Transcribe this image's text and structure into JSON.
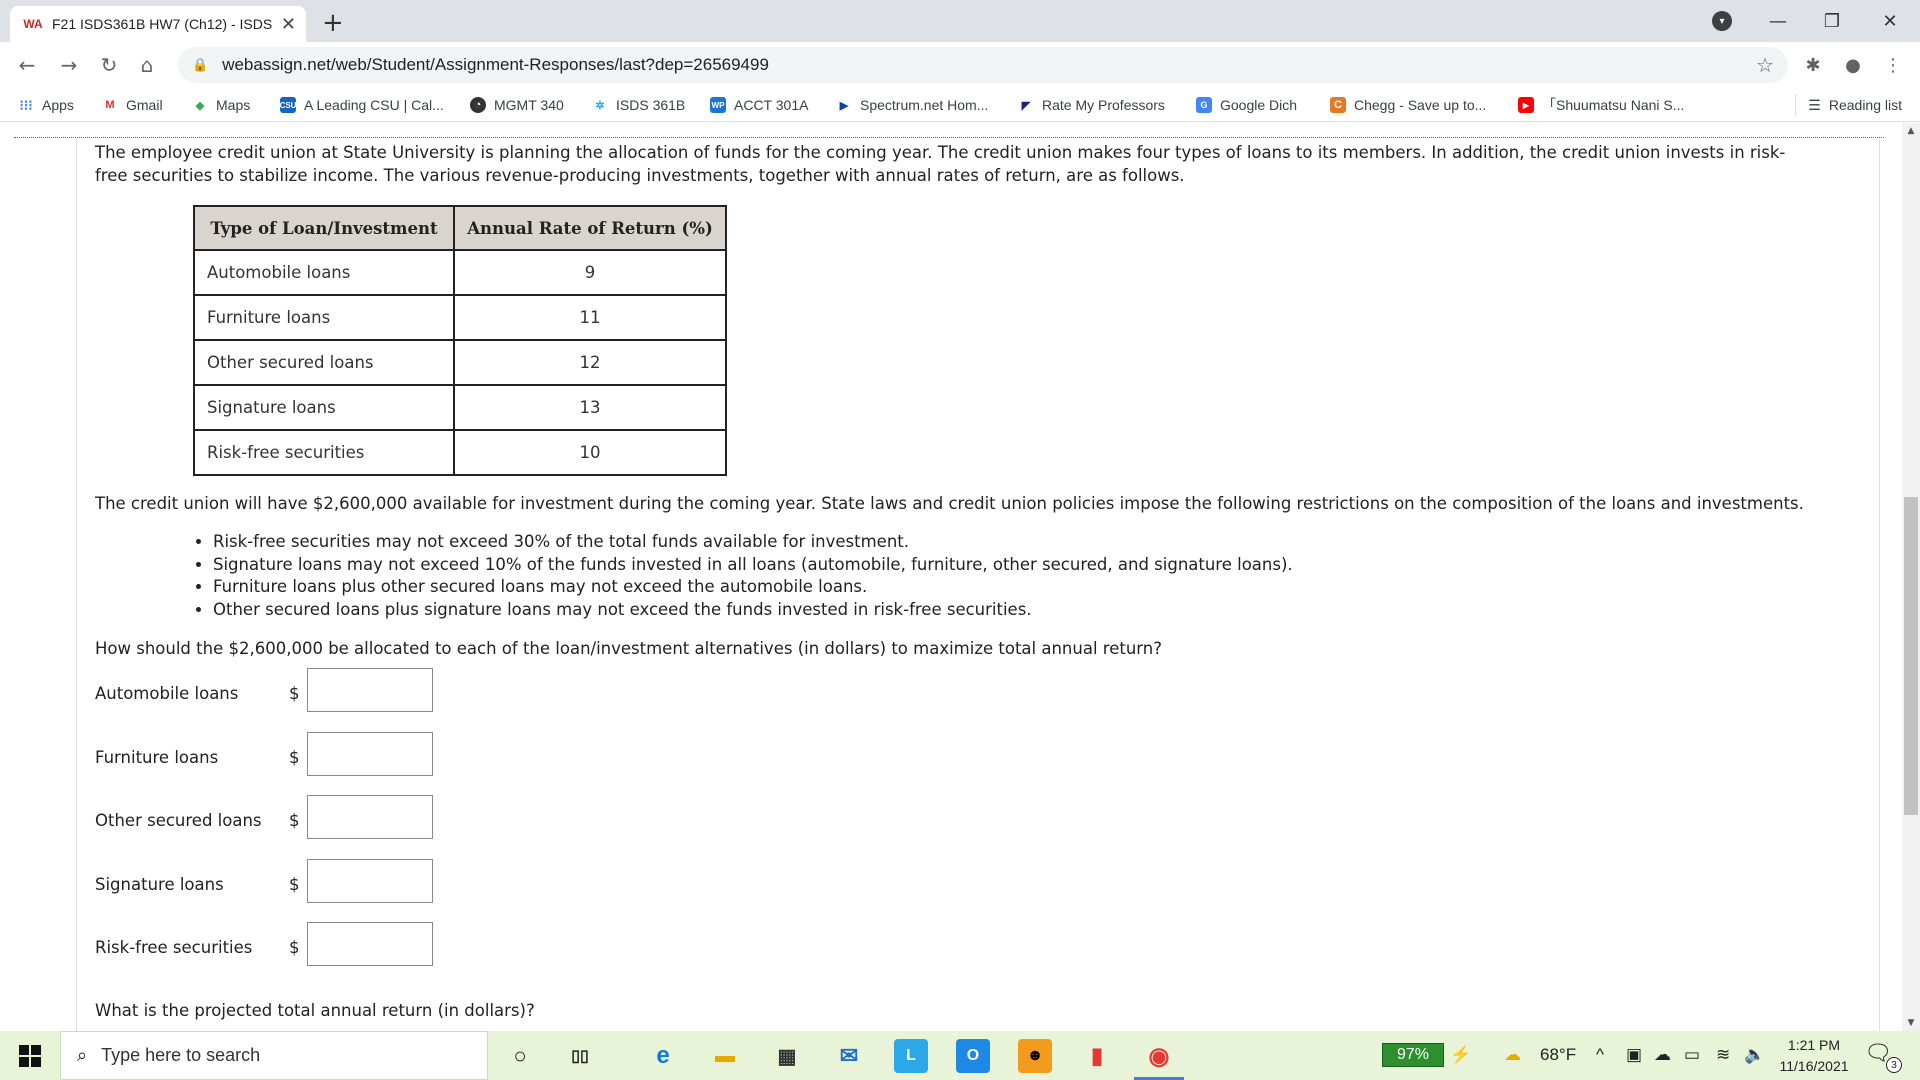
{
  "browser": {
    "tab_title": "F21 ISDS361B HW7 (Ch12) - ISDS",
    "tab_favicon": "WA",
    "new_tab": "+",
    "url": "webassign.net/web/Student/Assignment-Responses/last?dep=26569499",
    "bookmarks": [
      {
        "label": "Apps",
        "icon": "apps-grid-icon"
      },
      {
        "label": "Gmail",
        "icon": "gmail-icon"
      },
      {
        "label": "Maps",
        "icon": "maps-icon"
      },
      {
        "label": "A Leading CSU | Cal...",
        "icon": "csu-icon"
      },
      {
        "label": "MGMT 340",
        "icon": "mgmt-icon"
      },
      {
        "label": "ISDS 361B",
        "icon": "isds-icon"
      },
      {
        "label": "ACCT 301A",
        "icon": "wp-icon"
      },
      {
        "label": "Spectrum.net Hom...",
        "icon": "spectrum-icon"
      },
      {
        "label": "Rate My Professors",
        "icon": "rmp-icon"
      },
      {
        "label": "Google Dich",
        "icon": "google-translate-icon"
      },
      {
        "label": "Chegg - Save up to...",
        "icon": "chegg-icon"
      },
      {
        "label": "「Shuumatsu Nani S...",
        "icon": "youtube-icon"
      }
    ],
    "reading_list": "Reading list"
  },
  "problem": {
    "intro": "The employee credit union at State University is planning the allocation of funds for the coming year. The credit union makes four types of loans to its members. In addition, the credit union invests in risk-free securities to stabilize income. The various revenue-producing investments, together with annual rates of return, are as follows.",
    "table": {
      "headers": [
        "Type of Loan/Investment",
        "Annual Rate of Return (%)"
      ],
      "rows": [
        [
          "Automobile loans",
          "9"
        ],
        [
          "Furniture loans",
          "11"
        ],
        [
          "Other secured loans",
          "12"
        ],
        [
          "Signature loans",
          "13"
        ],
        [
          "Risk-free securities",
          "10"
        ]
      ]
    },
    "constraints_intro": "The credit union will have $2,600,000 available for investment during the coming year. State laws and credit union policies impose the following restrictions on the composition of the loans and investments.",
    "rules": [
      "Risk-free securities may not exceed 30% of the total funds available for investment.",
      "Signature loans may not exceed 10% of the funds invested in all loans (automobile, furniture, other secured, and signature loans).",
      "Furniture loans plus other secured loans may not exceed the automobile loans.",
      "Other secured loans plus signature loans may not exceed the funds invested in risk-free securities."
    ],
    "question": "How should the $2,600,000 be allocated to each of the loan/investment alternatives (in dollars) to maximize total annual return?",
    "currency": "$",
    "answers": [
      {
        "label": "Automobile loans",
        "value": ""
      },
      {
        "label": "Furniture loans",
        "value": ""
      },
      {
        "label": "Other secured loans",
        "value": ""
      },
      {
        "label": "Signature loans",
        "value": ""
      },
      {
        "label": "Risk-free securities",
        "value": ""
      }
    ],
    "final_question": "What is the projected total annual return (in dollars)?"
  },
  "taskbar": {
    "search_placeholder": "Type here to search",
    "battery": "97%",
    "temperature": "68°F",
    "time": "1:21 PM",
    "date": "11/16/2021",
    "notifications": "3"
  }
}
